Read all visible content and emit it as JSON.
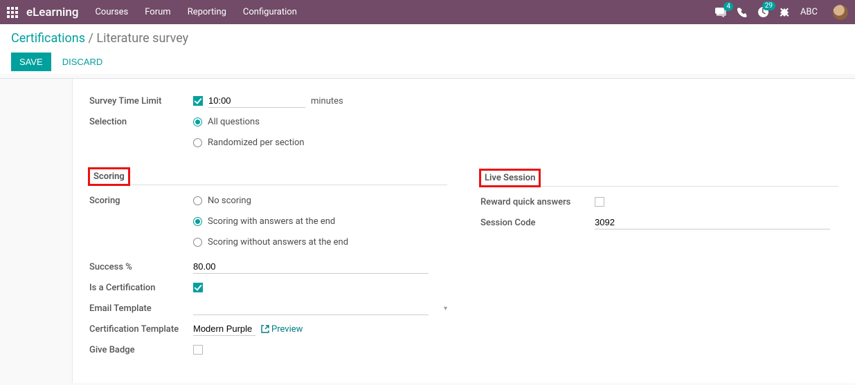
{
  "topbar": {
    "app_title": "eLearning",
    "nav": [
      "Courses",
      "Forum",
      "Reporting",
      "Configuration"
    ],
    "chat_badge": "4",
    "activity_badge": "29",
    "user_label": "ABC"
  },
  "breadcrumb": {
    "root": "Certifications",
    "sep": " / ",
    "leaf": "Literature survey"
  },
  "actions": {
    "save": "SAVE",
    "discard": "DISCARD"
  },
  "left_col": {
    "survey_time_limit_label": "Survey Time Limit",
    "survey_time_limit_checked": true,
    "survey_time_value": "10:00",
    "survey_time_unit": "minutes",
    "selection_label": "Selection",
    "selection_opts": {
      "all": "All questions",
      "random": "Randomized per section"
    },
    "scoring_section_title": "Scoring",
    "scoring_label": "Scoring",
    "scoring_opts": {
      "none": "No scoring",
      "with_answers": "Scoring with answers at the end",
      "without_answers": "Scoring without answers at the end"
    },
    "success_pct_label": "Success %",
    "success_pct_value": "80.00",
    "is_cert_label": "Is a Certification",
    "is_cert_checked": true,
    "email_tmpl_label": "Email Template",
    "email_tmpl_value": "",
    "cert_tmpl_label": "Certification Template",
    "cert_tmpl_value": "Modern Purple",
    "preview_label": "Preview",
    "give_badge_label": "Give Badge",
    "give_badge_checked": false
  },
  "right_col": {
    "live_section_title": "Live Session",
    "reward_label": "Reward quick answers",
    "reward_checked": false,
    "session_code_label": "Session Code",
    "session_code_value": "3092"
  }
}
